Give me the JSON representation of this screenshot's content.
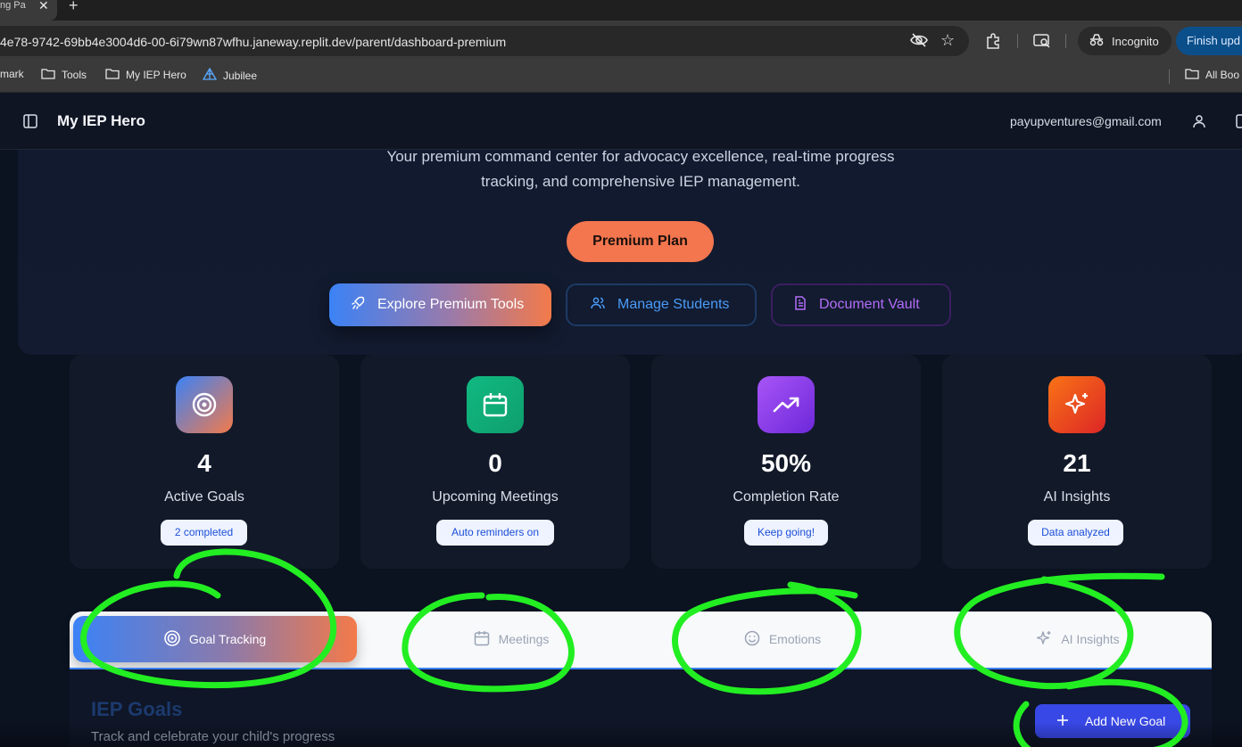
{
  "browser": {
    "tab_title": "ng Pa",
    "url": "4e78-9742-69bb4e3004d6-00-6i79wn87wfhu.janeway.replit.dev/parent/dashboard-premium",
    "incognito_label": "Incognito",
    "finish_update_label": "Finish upd",
    "bookmarks": [
      "mark",
      "Tools",
      "My IEP Hero",
      "Jubilee"
    ],
    "all_bookmarks_label": "All Boo"
  },
  "app": {
    "title": "My IEP Hero",
    "user_email": "payupventures@gmail.com"
  },
  "hero": {
    "subtitle_line1": "Your premium command center for advocacy excellence, real-time progress",
    "subtitle_line2": "tracking, and comprehensive IEP management.",
    "plan_label": "Premium Plan",
    "buttons": {
      "explore": "Explore Premium Tools",
      "students": "Manage Students",
      "vault": "Document Vault"
    }
  },
  "stats": [
    {
      "value": "4",
      "label": "Active Goals",
      "badge": "2 completed",
      "icon": "target-icon",
      "color_from": "#3b82f6",
      "color_to": "#f37a4a"
    },
    {
      "value": "0",
      "label": "Upcoming Meetings",
      "badge": "Auto reminders on",
      "icon": "calendar-icon",
      "color_from": "#10b981",
      "color_to": "#0f9f6e"
    },
    {
      "value": "50%",
      "label": "Completion Rate",
      "badge": "Keep going!",
      "icon": "trending-up-icon",
      "color_from": "#a855f7",
      "color_to": "#6d28d9"
    },
    {
      "value": "21",
      "label": "AI Insights",
      "badge": "Data analyzed",
      "icon": "sparkles-icon",
      "color_from": "#f97316",
      "color_to": "#dc2626"
    }
  ],
  "tabs": [
    {
      "label": "Goal Tracking",
      "icon": "target-icon",
      "active": true
    },
    {
      "label": "Meetings",
      "icon": "calendar-icon",
      "active": false
    },
    {
      "label": "Emotions",
      "icon": "smile-icon",
      "active": false
    },
    {
      "label": "AI Insights",
      "icon": "sparkles-icon",
      "active": false
    }
  ],
  "goals": {
    "title": "IEP Goals",
    "subtitle": "Track and celebrate your child's progress",
    "add_label": "Add New Goal"
  },
  "colors": {
    "annotation": "#22ee22",
    "accent_blue": "#3b82f6",
    "accent_orange": "#f37a4a"
  }
}
